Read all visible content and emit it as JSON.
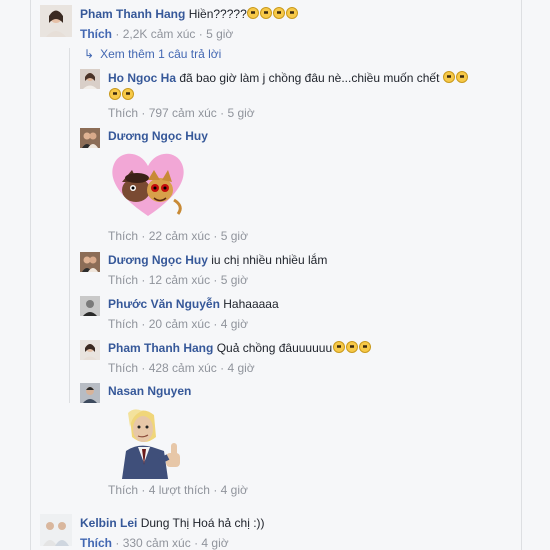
{
  "comments": [
    {
      "name": "Pham Thanh Hang",
      "text": "Hiền?????",
      "emoji_count": 4,
      "like": "Thích",
      "reactions": "2,2K cảm xúc",
      "time": "5 giờ"
    }
  ],
  "more_replies": "Xem thêm 1 câu trả lời",
  "replies": [
    {
      "name": "Ho Ngoc Ha",
      "text_line1": "đã bao giờ làm j chồng đâu nè...chiều muốn chết",
      "emoji_count_line1": 2,
      "emoji_count_line2": 2,
      "like": "Thích",
      "reactions": "797 cảm xúc",
      "time": "5 giờ"
    },
    {
      "name": "Dương Ngọc Huy",
      "sticker": "cats-in-heart-sticker",
      "like": "Thích",
      "reactions": "22 cảm xúc",
      "time": "5 giờ"
    },
    {
      "name": "Dương Ngọc Huy",
      "text": "iu chị nhiều nhiều lắm",
      "like": "Thích",
      "reactions": "12 cảm xúc",
      "time": "5 giờ"
    },
    {
      "name": "Phước Văn Nguyễn",
      "text": "Hahaaaaa",
      "like": "Thích",
      "reactions": "20 cảm xúc",
      "time": "4 giờ"
    },
    {
      "name": "Pham Thanh Hang",
      "text": "Quả chồng đâuuuuuu",
      "emoji_count": 3,
      "like": "Thích",
      "reactions": "428 cảm xúc",
      "time": "4 giờ"
    },
    {
      "name": "Nasan Nguyen",
      "sticker": "thumbs-up-man-sticker",
      "like": "Thích",
      "reactions": "4 lượt thích",
      "time": "4 giờ"
    }
  ],
  "last_comment": {
    "name": "Kelbin Lei",
    "text": "Dung Thị Hoá hả chị :))",
    "like": "Thích",
    "reactions": "330 cảm xúc",
    "time": "4 giờ"
  },
  "separator": "·",
  "colors": {
    "name_link": "#365899",
    "like_link": "#4267b2",
    "meta_gray": "#90949c",
    "background": "#f6f7f9"
  }
}
